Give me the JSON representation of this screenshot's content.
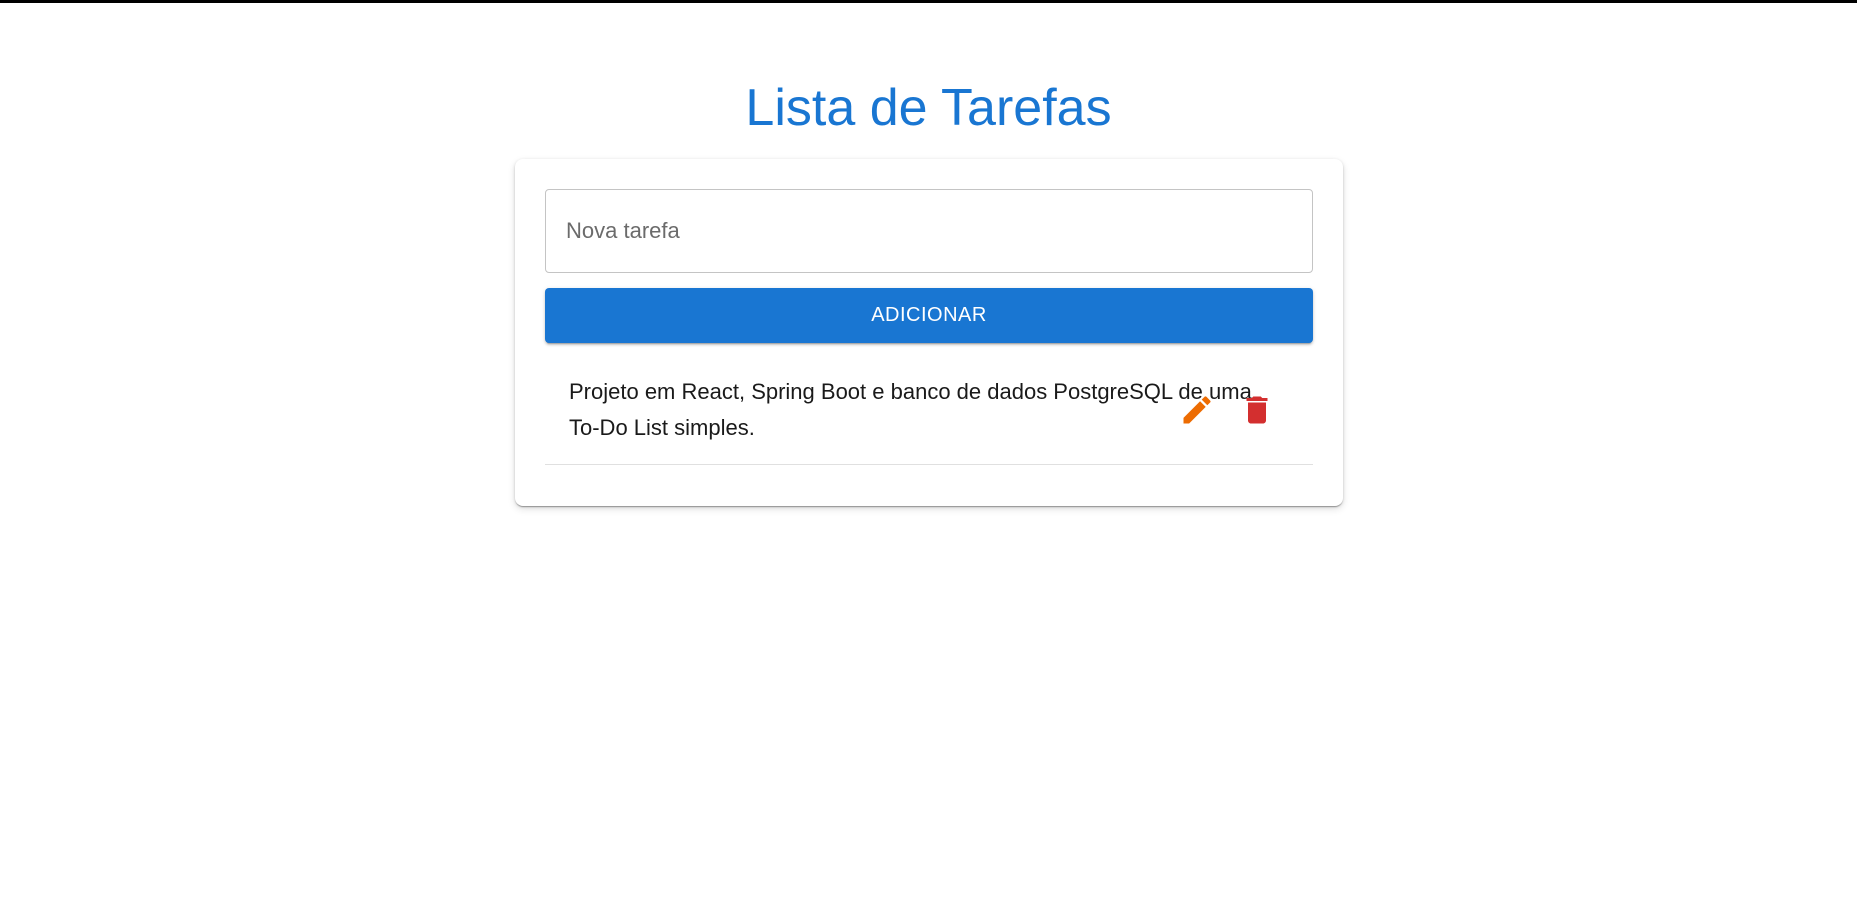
{
  "page": {
    "title": "Lista de Tarefas"
  },
  "form": {
    "input_placeholder": "Nova tarefa",
    "input_value": "",
    "add_label": "ADICIONAR"
  },
  "tasks": [
    {
      "text": "Projeto em React, Spring Boot e banco de dados PostgreSQL de uma To-Do List simples.",
      "edit_icon": "pencil-icon",
      "delete_icon": "trash-icon"
    }
  ],
  "colors": {
    "primary": "#1976d2",
    "edit": "#ed6c02",
    "delete": "#d32f2f"
  }
}
